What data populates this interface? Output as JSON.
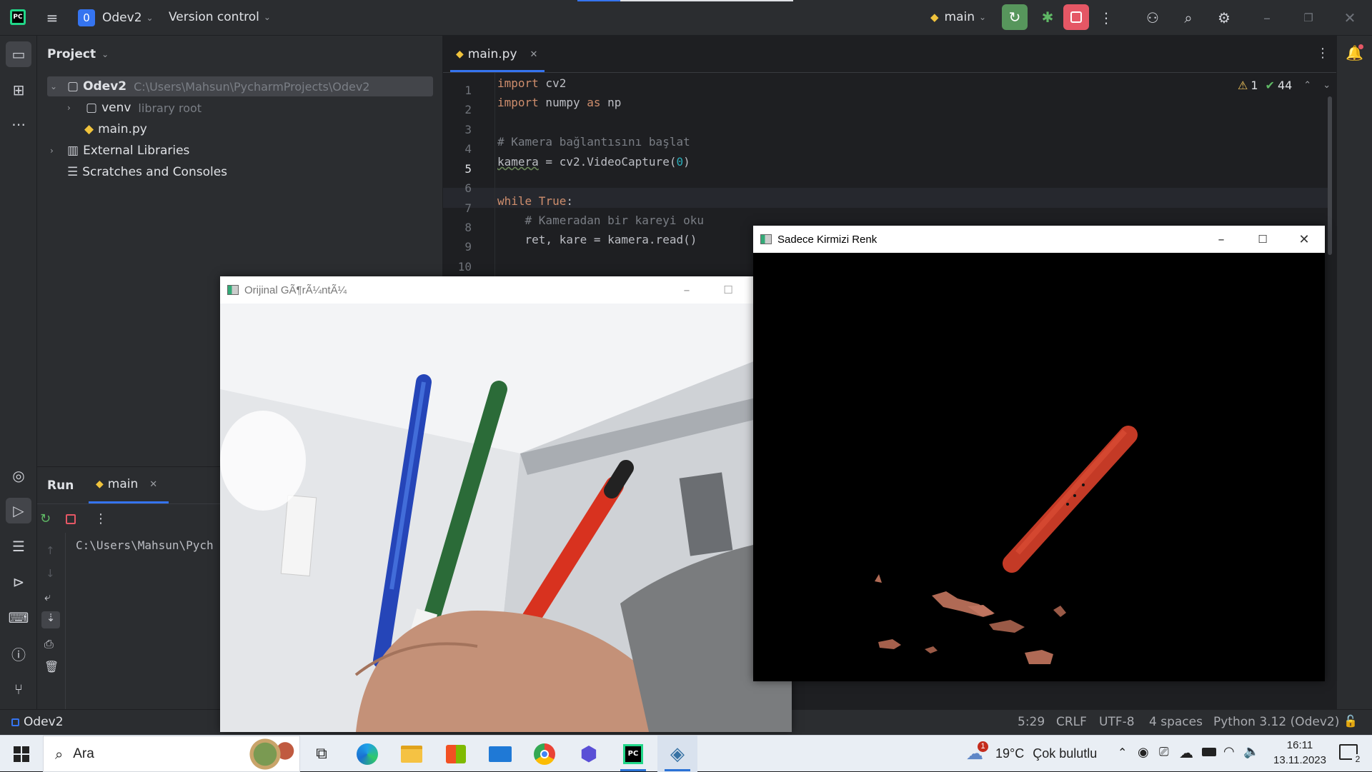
{
  "titlebar": {
    "project_badge": "0",
    "project_name": "Odev2",
    "vcs": "Version control",
    "run_config": "main"
  },
  "project_panel": {
    "title": "Project",
    "tree": [
      {
        "label": "Odev2",
        "hint": "C:\\Users\\Mahsun\\PycharmProjects\\Odev2"
      },
      {
        "label": "venv",
        "hint": "library root"
      },
      {
        "label": "main.py",
        "hint": ""
      },
      {
        "label": "External Libraries",
        "hint": ""
      },
      {
        "label": "Scratches and Consoles",
        "hint": ""
      }
    ]
  },
  "editor": {
    "tab": "main.py",
    "inspections": {
      "warnings": "1",
      "ok": "44"
    },
    "lines": [
      "1",
      "2",
      "3",
      "4",
      "5",
      "6",
      "7",
      "8",
      "9",
      "10"
    ],
    "code": {
      "l1a": "import",
      "l1b": " cv2",
      "l2a": "import",
      "l2b": " numpy ",
      "l2c": "as",
      "l2d": " np",
      "l4": "# Kamera bağlantısını başlat",
      "l5a": "kamera",
      "l5b": " = cv2.VideoCapture(",
      "l5c": "0",
      "l5d": ")",
      "l7a": "while",
      "l7b": " True",
      "l7c": ":",
      "l8": "    # Kameradan bir kareyi oku",
      "l9": "    ret, kare = kamera.read()"
    }
  },
  "run_panel": {
    "title": "Run",
    "tab": "main",
    "console": "C:\\Users\\Mahsun\\Pych"
  },
  "statusbar": {
    "project": "Odev2",
    "position": "5:29",
    "line_sep": "CRLF",
    "encoding": "UTF-8",
    "indent": "4 spaces",
    "interpreter": "Python 3.12 (Odev2)"
  },
  "windows": {
    "original_title": "Orijinal GÃ¶rÃ¼ntÃ¼",
    "red_title": "Sadece Kirmizi Renk"
  },
  "taskbar": {
    "search_placeholder": "Ara",
    "weather_temp": "19°C",
    "weather_text": "Çok bulutlu",
    "weather_badge": "1",
    "time": "16:11",
    "date": "13.11.2023",
    "notif_count": "2"
  },
  "colors": {
    "accent": "#3574f0",
    "run_green": "#57965c",
    "stop_red": "#e55765"
  }
}
